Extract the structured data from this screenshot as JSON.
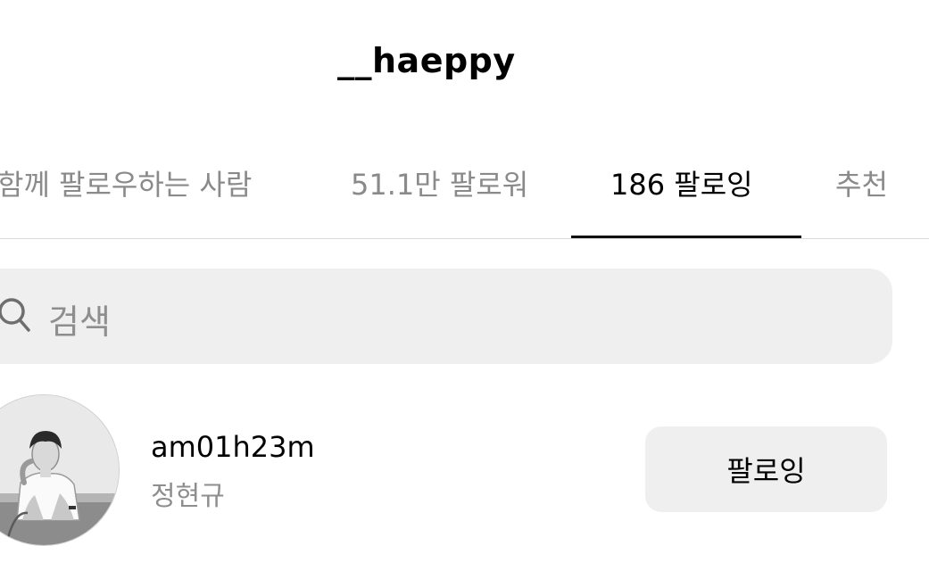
{
  "header": {
    "title": "__haeppy"
  },
  "tabs": [
    {
      "label": "함께 팔로우하는 사람",
      "active": false
    },
    {
      "label": "51.1만 팔로워",
      "active": false
    },
    {
      "label": "186 팔로잉",
      "active": true
    },
    {
      "label": "추천",
      "active": false
    }
  ],
  "search": {
    "placeholder": "검색",
    "icon": "search-icon"
  },
  "following_list": [
    {
      "username": "am01h23m",
      "full_name": "정현규",
      "button_label": "팔로잉",
      "avatar": "avatar-photo"
    }
  ],
  "colors": {
    "active_tab": "#000000",
    "inactive_tab": "#8a8a8a",
    "search_bg": "#efefef",
    "button_bg": "#efefef",
    "secondary_text": "#8e8e8e"
  }
}
